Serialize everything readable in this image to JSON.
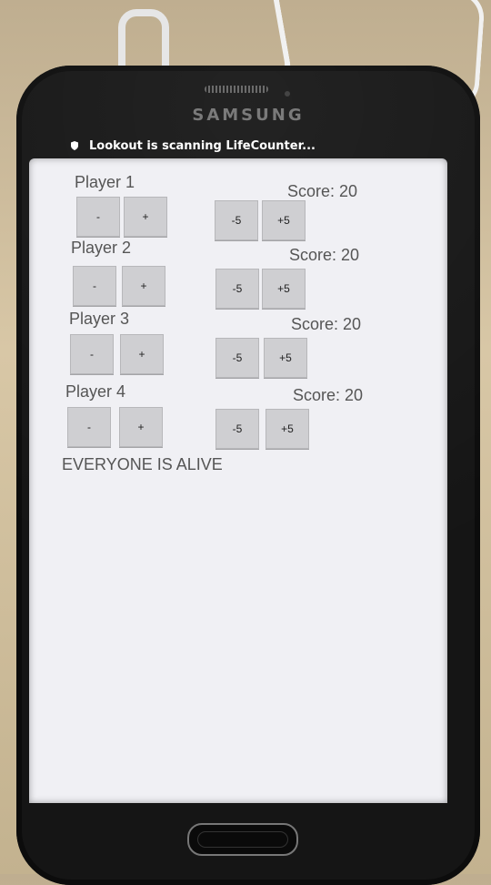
{
  "notification": {
    "text": "Lookout is scanning LifeCounter..."
  },
  "device": {
    "brand": "SAMSUNG"
  },
  "players": [
    {
      "name": "Player 1",
      "score": "Score: 20",
      "minus": "-",
      "plus": "+",
      "minus5": "-5",
      "plus5": "+5"
    },
    {
      "name": "Player 2",
      "score": "Score: 20",
      "minus": "-",
      "plus": "+",
      "minus5": "-5",
      "plus5": "+5"
    },
    {
      "name": "Player 3",
      "score": "Score: 20",
      "minus": "-",
      "plus": "+",
      "minus5": "-5",
      "plus5": "+5"
    },
    {
      "name": "Player 4",
      "score": "Score: 20",
      "minus": "-",
      "plus": "+",
      "minus5": "-5",
      "plus5": "+5"
    }
  ],
  "status": "EVERYONE IS ALIVE",
  "icons": {
    "notification": "shield-icon"
  }
}
